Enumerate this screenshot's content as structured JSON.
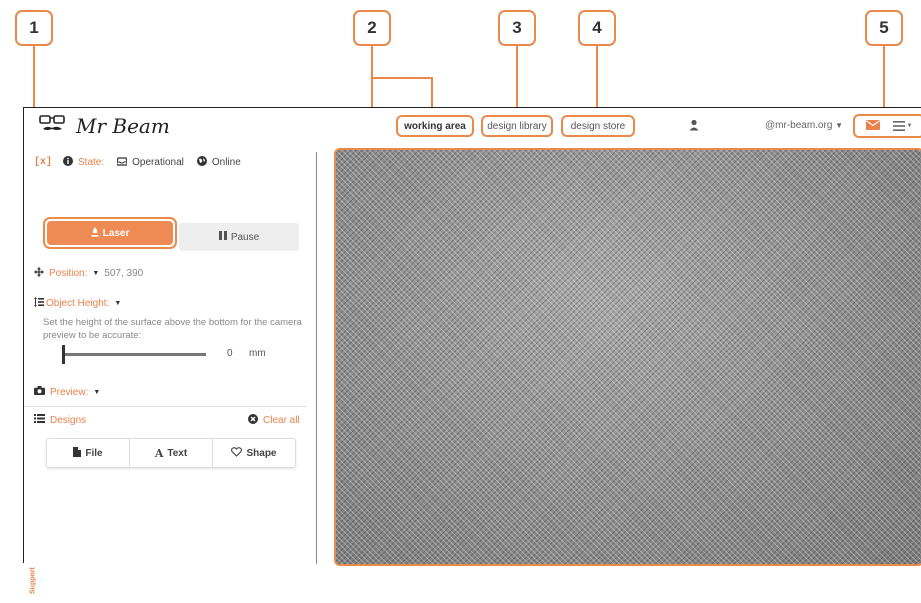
{
  "callouts": [
    "1",
    "2",
    "3",
    "4",
    "5"
  ],
  "app": {
    "logo_text": "Mr Beam",
    "nav": {
      "working_area": "working area",
      "design_library": "design library",
      "design_store": "design store"
    },
    "user_email": "@mr-beam.org"
  },
  "sidebar": {
    "reconnect": "[x]",
    "state_label": "State:",
    "state_value": "Operational",
    "online": "Online",
    "laser_label": "Laser",
    "pause_label": "Pause",
    "position_label": "Position:",
    "position_value": "507, 390",
    "object_height_label": "Object Height:",
    "object_height_hint": "Set the height of the surface above the bottom for the camera preview to be accurate:",
    "object_height_value": "0",
    "object_height_unit": "mm",
    "preview_label": "Preview:",
    "designs_label": "Designs",
    "clear_all": "Clear all",
    "file_label": "File",
    "text_label": "Text",
    "shape_label": "Shape",
    "support": "Support"
  },
  "colors": {
    "accent": "#e9824a",
    "callout_border": "#e98a4a"
  },
  "icons": [
    "glasses-mustache-icon",
    "info-icon",
    "inbox-icon",
    "globe-icon",
    "laser-icon",
    "pause-icon",
    "move-icon",
    "height-icon",
    "camera-icon",
    "list-icon",
    "x-circle-icon",
    "file-icon",
    "font-icon",
    "heart-icon",
    "user-icon",
    "envelope-icon",
    "hamburger-menu-icon",
    "caret-down-icon"
  ]
}
